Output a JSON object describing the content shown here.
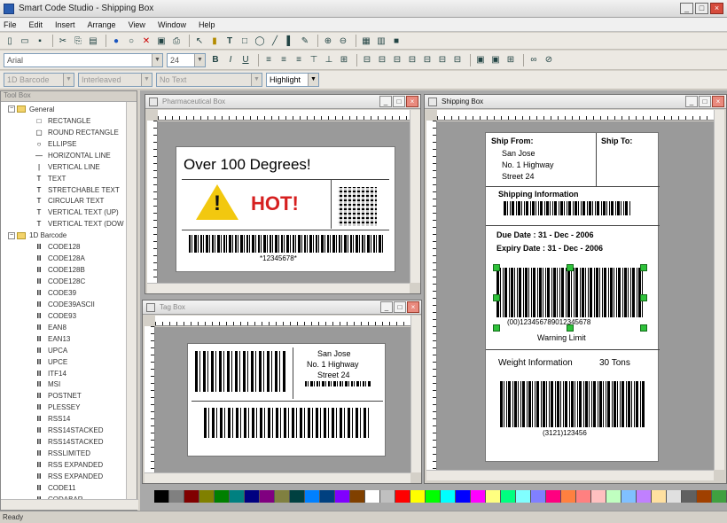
{
  "window": {
    "title": "Smart Code Studio - Shipping Box"
  },
  "menu": [
    "File",
    "Edit",
    "Insert",
    "Arrange",
    "View",
    "Window",
    "Help"
  ],
  "toolbar2": {
    "font": "Arial",
    "size": "24"
  },
  "toolbar3": {
    "combo1": "1D Barcode",
    "combo2": "Interleaved",
    "combo3": "No Text",
    "combo4": "Highlight"
  },
  "sidebar": {
    "title": "Tool Box",
    "groups": [
      {
        "label": "General",
        "items": [
          {
            "label": "RECTANGLE",
            "icon": "rectangle-icon",
            "glyph": "□"
          },
          {
            "label": "ROUND RECTANGLE",
            "icon": "round-rectangle-icon",
            "glyph": "▢"
          },
          {
            "label": "ELLIPSE",
            "icon": "ellipse-icon",
            "glyph": "○"
          },
          {
            "label": "HORIZONTAL LINE",
            "icon": "horizontal-line-icon",
            "glyph": "—"
          },
          {
            "label": "VERTICAL LINE",
            "icon": "vertical-line-icon",
            "glyph": "|"
          },
          {
            "label": "TEXT",
            "icon": "text-icon",
            "glyph": "T"
          },
          {
            "label": "STRETCHABLE TEXT",
            "icon": "text-icon",
            "glyph": "T"
          },
          {
            "label": "CIRCULAR TEXT",
            "icon": "text-icon",
            "glyph": "T"
          },
          {
            "label": "VERTICAL TEXT (UP)",
            "icon": "text-icon",
            "glyph": "T"
          },
          {
            "label": "VERTICAL TEXT (DOW",
            "icon": "text-icon",
            "glyph": "T"
          }
        ]
      },
      {
        "label": "1D Barcode",
        "items": [
          {
            "label": "CODE128",
            "icon": "barcode-icon",
            "glyph": "Ⅲ"
          },
          {
            "label": "CODE128A",
            "icon": "barcode-icon",
            "glyph": "Ⅲ"
          },
          {
            "label": "CODE128B",
            "icon": "barcode-icon",
            "glyph": "Ⅲ"
          },
          {
            "label": "CODE128C",
            "icon": "barcode-icon",
            "glyph": "Ⅲ"
          },
          {
            "label": "CODE39",
            "icon": "barcode-icon",
            "glyph": "Ⅲ"
          },
          {
            "label": "CODE39ASCII",
            "icon": "barcode-icon",
            "glyph": "Ⅲ"
          },
          {
            "label": "CODE93",
            "icon": "barcode-icon",
            "glyph": "Ⅲ"
          },
          {
            "label": "EAN8",
            "icon": "barcode-icon",
            "glyph": "Ⅲ"
          },
          {
            "label": "EAN13",
            "icon": "barcode-icon",
            "glyph": "Ⅲ"
          },
          {
            "label": "UPCA",
            "icon": "barcode-icon",
            "glyph": "Ⅲ"
          },
          {
            "label": "UPCE",
            "icon": "barcode-icon",
            "glyph": "Ⅲ"
          },
          {
            "label": "ITF14",
            "icon": "barcode-icon",
            "glyph": "Ⅲ"
          },
          {
            "label": "MSI",
            "icon": "barcode-icon",
            "glyph": "Ⅲ"
          },
          {
            "label": "POSTNET",
            "icon": "barcode-icon",
            "glyph": "Ⅲ"
          },
          {
            "label": "PLESSEY",
            "icon": "barcode-icon",
            "glyph": "Ⅲ"
          },
          {
            "label": "RSS14",
            "icon": "barcode-icon",
            "glyph": "Ⅲ"
          },
          {
            "label": "RSS14STACKED",
            "icon": "barcode-icon",
            "glyph": "Ⅲ"
          },
          {
            "label": "RSS14STACKED",
            "icon": "barcode-icon",
            "glyph": "Ⅲ"
          },
          {
            "label": "RSSLIMITED",
            "icon": "barcode-icon",
            "glyph": "Ⅲ"
          },
          {
            "label": "RSS EXPANDED",
            "icon": "barcode-icon",
            "glyph": "Ⅲ"
          },
          {
            "label": "RSS EXPANDED",
            "icon": "barcode-icon",
            "glyph": "Ⅲ"
          },
          {
            "label": "CODE11",
            "icon": "barcode-icon",
            "glyph": "Ⅲ"
          },
          {
            "label": "CODABAR",
            "icon": "barcode-icon",
            "glyph": "Ⅲ"
          }
        ]
      }
    ]
  },
  "windows": {
    "pharma": {
      "title": "Pharmaceutical Box",
      "heading": "Over 100 Degrees!",
      "hot": "HOT!",
      "warn_mark": "!",
      "barcode_text": "*12345678*"
    },
    "tag": {
      "title": "Tag Box",
      "addr1": "San Jose",
      "addr2": "No. 1 Highway",
      "addr3": "Street 24"
    },
    "shipping": {
      "title": "Shipping Box",
      "ship_from": "Ship From:",
      "ship_to": "Ship To:",
      "addr1": "San Jose",
      "addr2": "No. 1 Highway",
      "addr3": "Street 24",
      "shipping_info": "Shipping Information",
      "due_date": "Due Date : 31 - Dec - 2006",
      "expiry_date": "Expiry Date : 31 - Dec - 2006",
      "barcode_text": "(00)123456789012345678",
      "warning_limit": "Warning Limit",
      "weight_info": "Weight Information",
      "weight_value": "30 Tons",
      "barcode2_text": "(3121)123456"
    }
  },
  "palette": [
    "#000000",
    "#808080",
    "#800000",
    "#808000",
    "#008000",
    "#008080",
    "#000080",
    "#800080",
    "#808040",
    "#004040",
    "#0080ff",
    "#004080",
    "#8000ff",
    "#804000",
    "#ffffff",
    "#c0c0c0",
    "#ff0000",
    "#ffff00",
    "#00ff00",
    "#00ffff",
    "#0000ff",
    "#ff00ff",
    "#ffff80",
    "#00ff80",
    "#80ffff",
    "#8080ff",
    "#ff0080",
    "#ff8040",
    "#ff8080",
    "#ffc0c0",
    "#c0ffc0",
    "#80c0ff",
    "#c080ff",
    "#ffe0a0",
    "#e0e0e0",
    "#606060",
    "#a04000",
    "#40a040"
  ],
  "status": {
    "text": "Ready"
  }
}
